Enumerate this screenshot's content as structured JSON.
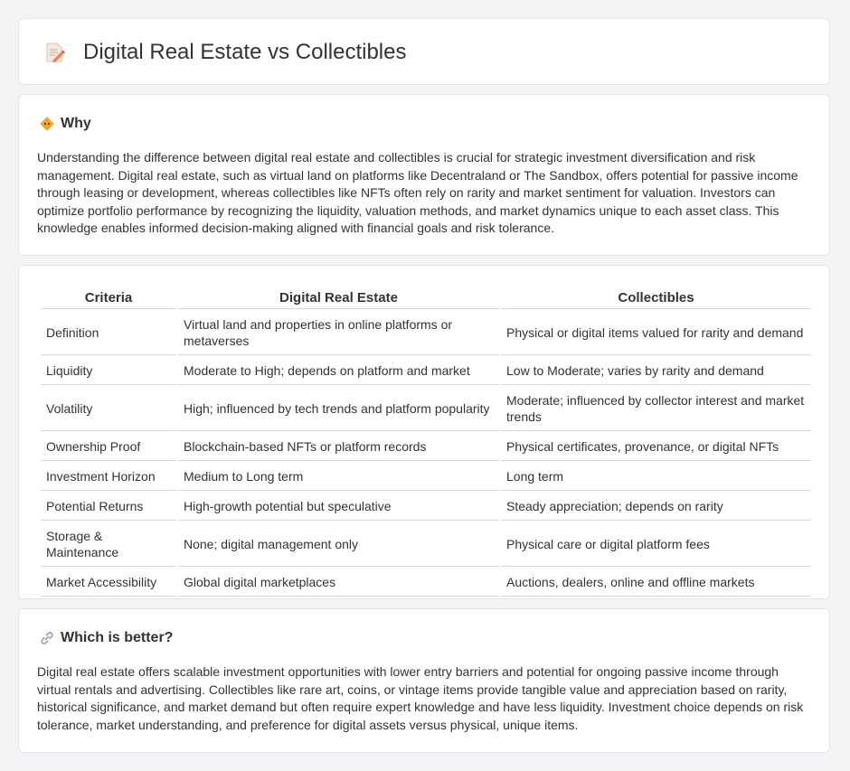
{
  "header": {
    "title": "Digital Real Estate vs Collectibles",
    "icon": "document-pencil-icon"
  },
  "why": {
    "heading": "Why",
    "icon": "diamond-sign-icon",
    "body": "Understanding the difference between digital real estate and collectibles is crucial for strategic investment diversification and risk management. Digital real estate, such as virtual land on platforms like Decentraland or The Sandbox, offers potential for passive income through leasing or development, whereas collectibles like NFTs often rely on rarity and market sentiment for valuation. Investors can optimize portfolio performance by recognizing the liquidity, valuation methods, and market dynamics unique to each asset class. This knowledge enables informed decision-making aligned with financial goals and risk tolerance."
  },
  "table": {
    "headers": [
      "Criteria",
      "Digital Real Estate",
      "Collectibles"
    ],
    "rows": [
      [
        "Definition",
        "Virtual land and properties in online platforms or metaverses",
        "Physical or digital items valued for rarity and demand"
      ],
      [
        "Liquidity",
        "Moderate to High; depends on platform and market",
        "Low to Moderate; varies by rarity and demand"
      ],
      [
        "Volatility",
        "High; influenced by tech trends and platform popularity",
        "Moderate; influenced by collector interest and market trends"
      ],
      [
        "Ownership Proof",
        "Blockchain-based NFTs or platform records",
        "Physical certificates, provenance, or digital NFTs"
      ],
      [
        "Investment Horizon",
        "Medium to Long term",
        "Long term"
      ],
      [
        "Potential Returns",
        "High-growth potential but speculative",
        "Steady appreciation; depends on rarity"
      ],
      [
        "Storage & Maintenance",
        "None; digital management only",
        "Physical care or digital platform fees"
      ],
      [
        "Market Accessibility",
        "Global digital marketplaces",
        "Auctions, dealers, online and offline markets"
      ]
    ]
  },
  "better": {
    "heading": "Which is better?",
    "icon": "link-icon",
    "body": "Digital real estate offers scalable investment opportunities with lower entry barriers and potential for ongoing passive income through virtual rentals and advertising. Collectibles like rare art, coins, or vintage items provide tangible value and appreciation based on rarity, historical significance, and market demand but often require expert knowledge and have less liquidity. Investment choice depends on risk tolerance, market understanding, and preference for digital assets versus physical, unique items."
  }
}
